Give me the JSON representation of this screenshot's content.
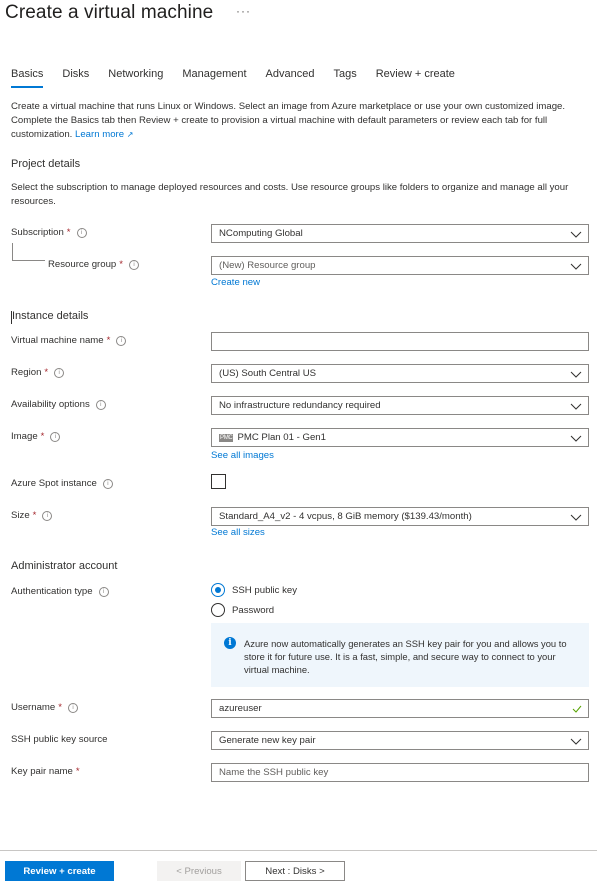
{
  "header": {
    "title": "Create a virtual machine",
    "more_label": "···"
  },
  "tabs": [
    {
      "label": "Basics",
      "active": true
    },
    {
      "label": "Disks",
      "active": false
    },
    {
      "label": "Networking",
      "active": false
    },
    {
      "label": "Management",
      "active": false
    },
    {
      "label": "Advanced",
      "active": false
    },
    {
      "label": "Tags",
      "active": false
    },
    {
      "label": "Review + create",
      "active": false
    }
  ],
  "intro": {
    "text": "Create a virtual machine that runs Linux or Windows. Select an image from Azure marketplace or use your own customized image. Complete the Basics tab then Review + create to provision a virtual machine with default parameters or review each tab for full customization. ",
    "learn_more": "Learn more",
    "external_icon": "↗"
  },
  "project": {
    "heading": "Project details",
    "description": "Select the subscription to manage deployed resources and costs. Use resource groups like folders to organize and manage all your resources.",
    "subscription": {
      "label": "Subscription",
      "required": "*",
      "value": "NComputing Global"
    },
    "resource_group": {
      "label": "Resource group",
      "required": "*",
      "placeholder": "(New) Resource group",
      "create_new": "Create new"
    }
  },
  "instance": {
    "heading": "Instance details",
    "vm_name": {
      "label": "Virtual machine name",
      "required": "*",
      "value": ""
    },
    "region": {
      "label": "Region",
      "required": "*",
      "value": "(US) South Central US"
    },
    "availability": {
      "label": "Availability options",
      "value": "No infrastructure redundancy required"
    },
    "image": {
      "label": "Image",
      "required": "*",
      "value": "PMC Plan 01 - Gen1",
      "logo_text": "PMC",
      "see_all": "See all images"
    },
    "spot": {
      "label": "Azure Spot instance",
      "checked": false
    },
    "size": {
      "label": "Size",
      "required": "*",
      "value": "Standard_A4_v2 - 4 vcpus, 8 GiB memory ($139.43/month)",
      "see_all": "See all sizes"
    }
  },
  "admin": {
    "heading": "Administrator account",
    "auth_type": {
      "label": "Authentication type",
      "options": [
        {
          "label": "SSH public key",
          "selected": true
        },
        {
          "label": "Password",
          "selected": false
        }
      ]
    },
    "info_message": "Azure now automatically generates an SSH key pair for you and allows you to store it for future use. It is a fast, simple, and secure way to connect to your virtual machine.",
    "username": {
      "label": "Username",
      "required": "*",
      "value": "azureuser",
      "valid": true
    },
    "ssh_source": {
      "label": "SSH public key source",
      "value": "Generate new key pair"
    },
    "key_pair_name": {
      "label": "Key pair name",
      "required": "*",
      "placeholder": "Name the SSH public key"
    }
  },
  "footer": {
    "review_create": "Review + create",
    "previous": "< Previous",
    "next": "Next : Disks >"
  },
  "colors": {
    "accent": "#0078d4",
    "required": "#a4262c",
    "valid": "#57a300",
    "info_bg": "#eff6fc"
  }
}
